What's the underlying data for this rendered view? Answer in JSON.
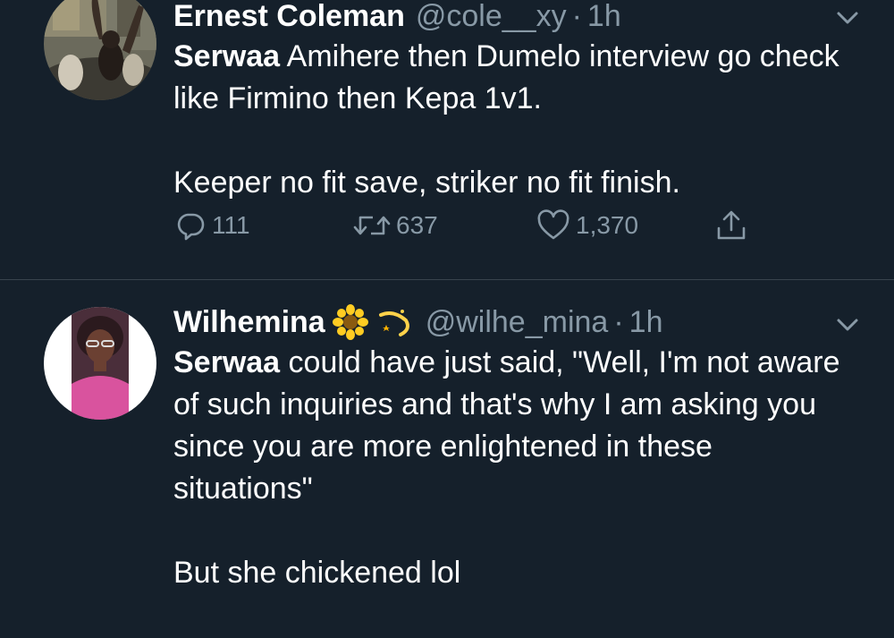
{
  "tweets": [
    {
      "author": "Ernest Coleman",
      "handle": "@cole__xy",
      "separator": "·",
      "time": "1h",
      "mention": "Serwaa",
      "text_after_mention": " Amihere then Dumelo interview go check like Firmino then Kepa 1v1.\n\nKeeper no fit save, striker no fit finish.",
      "replies": "111",
      "retweets": "637",
      "likes": "1,370",
      "icons": [
        "reply-icon",
        "retweet-icon",
        "like-icon",
        "share-icon",
        "chevron-down-icon"
      ]
    },
    {
      "author": "Wilhemina",
      "author_emojis": [
        "sunflower-emoji",
        "dizzy-emoji"
      ],
      "handle": "@wilhe_mina",
      "separator": "·",
      "time": "1h",
      "mention": "Serwaa",
      "text_after_mention": " could have just said, \"Well, I'm not aware of such inquiries and that's why I am asking you since you are more enlightened in these situations\"\n\nBut she chickened lol",
      "icons": [
        "chevron-down-icon"
      ]
    }
  ],
  "colors": {
    "background": "#15202b",
    "text": "#ffffff",
    "secondary_text": "#8899a6",
    "divider": "#38444d"
  }
}
